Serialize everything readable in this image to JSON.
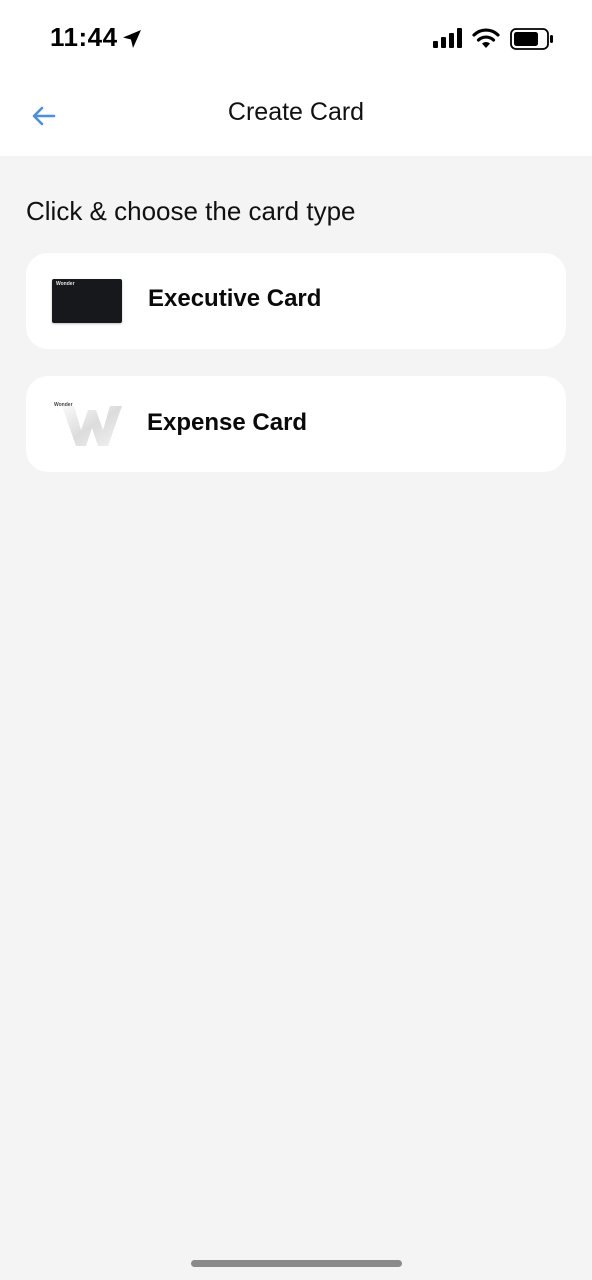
{
  "status_bar": {
    "time": "11:44",
    "icons": [
      "location-arrow-icon",
      "cellular-signal-icon",
      "wifi-icon",
      "battery-icon"
    ]
  },
  "nav": {
    "title": "Create Card",
    "back_icon": "arrow-left-icon"
  },
  "heading": "Click & choose the card type",
  "card_types": [
    {
      "label": "Executive Card",
      "thumb_brand": "Wonder",
      "thumb_style": "dark"
    },
    {
      "label": "Expense Card",
      "thumb_brand": "Wonder",
      "thumb_style": "light"
    }
  ],
  "colors": {
    "accent": "#4a90e2",
    "background": "#f4f4f4",
    "surface": "#ffffff",
    "exec_card": "#17181b"
  }
}
